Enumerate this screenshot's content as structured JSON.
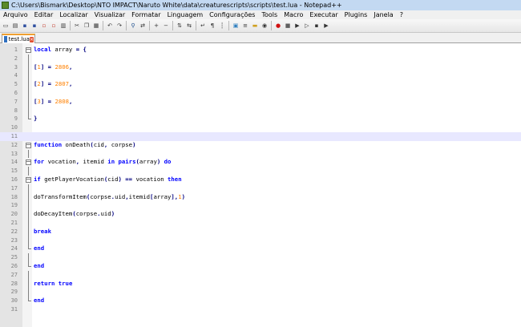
{
  "window": {
    "title": "C:\\Users\\Bismark\\Desktop\\NTO IMPACT\\Naruto White\\data\\creaturescripts\\scripts\\test.lua - Notepad++"
  },
  "menu": [
    "Arquivo",
    "Editar",
    "Localizar",
    "Visualizar",
    "Formatar",
    "Linguagem",
    "Configurações",
    "Tools",
    "Macro",
    "Executar",
    "Plugins",
    "Janela",
    "?"
  ],
  "toolbar_icons": [
    "new-icon",
    "open-icon",
    "save-icon",
    "save-all-icon",
    "close-icon",
    "close-all-icon",
    "print-icon",
    "sep",
    "cut-icon",
    "copy-icon",
    "paste-icon",
    "sep",
    "undo-icon",
    "redo-icon",
    "sep",
    "find-icon",
    "replace-icon",
    "sep",
    "zoom-in-icon",
    "zoom-out-icon",
    "sep",
    "sync-v-icon",
    "sync-h-icon",
    "sep",
    "word-wrap-icon",
    "show-all-chars-icon",
    "indent-guide-icon",
    "sep",
    "document-map-icon",
    "function-list-icon",
    "folder-icon",
    "monitor-icon",
    "sep",
    "record-icon",
    "stop-icon",
    "play-icon",
    "run-multiple-icon",
    "save-macro-icon",
    "run-icon"
  ],
  "tab": {
    "label": "test.lua"
  },
  "colors": {
    "keyword": "#0000ff",
    "number": "#ff8000",
    "operator": "#000080",
    "current_line": "#e8e8ff"
  },
  "current_line": 11,
  "lines": [
    {
      "n": "1",
      "fold": "box",
      "tokens": [
        [
          "kw",
          "local"
        ],
        [
          "txt",
          " array "
        ],
        [
          "punc",
          "="
        ],
        [
          "txt",
          " "
        ],
        [
          "punc",
          "{"
        ]
      ]
    },
    {
      "n": "2",
      "fold": "vline",
      "tokens": []
    },
    {
      "n": "3",
      "fold": "vline",
      "tokens": [
        [
          "punc",
          "["
        ],
        [
          "num",
          "1"
        ],
        [
          "punc",
          "]"
        ],
        [
          "txt",
          " "
        ],
        [
          "punc",
          "="
        ],
        [
          "txt",
          " "
        ],
        [
          "num",
          "2806"
        ],
        [
          "punc",
          ","
        ]
      ]
    },
    {
      "n": "4",
      "fold": "vline",
      "tokens": []
    },
    {
      "n": "5",
      "fold": "vline",
      "tokens": [
        [
          "punc",
          "["
        ],
        [
          "num",
          "2"
        ],
        [
          "punc",
          "]"
        ],
        [
          "txt",
          " "
        ],
        [
          "punc",
          "="
        ],
        [
          "txt",
          " "
        ],
        [
          "num",
          "2807"
        ],
        [
          "punc",
          ","
        ]
      ]
    },
    {
      "n": "6",
      "fold": "vline",
      "tokens": []
    },
    {
      "n": "7",
      "fold": "vline",
      "tokens": [
        [
          "punc",
          "["
        ],
        [
          "num",
          "3"
        ],
        [
          "punc",
          "]"
        ],
        [
          "txt",
          " "
        ],
        [
          "punc",
          "="
        ],
        [
          "txt",
          " "
        ],
        [
          "num",
          "2808"
        ],
        [
          "punc",
          ","
        ]
      ]
    },
    {
      "n": "8",
      "fold": "vline",
      "tokens": []
    },
    {
      "n": "9",
      "fold": "endmark",
      "tokens": [
        [
          "punc",
          "}"
        ]
      ]
    },
    {
      "n": "10",
      "fold": "",
      "tokens": []
    },
    {
      "n": "11",
      "fold": "",
      "tokens": []
    },
    {
      "n": "12",
      "fold": "box",
      "tokens": [
        [
          "kw",
          "function"
        ],
        [
          "txt",
          " onDeath"
        ],
        [
          "punc",
          "("
        ],
        [
          "txt",
          "cid"
        ],
        [
          "punc",
          ","
        ],
        [
          "txt",
          " corpse"
        ],
        [
          "punc",
          ")"
        ]
      ]
    },
    {
      "n": "13",
      "fold": "vline",
      "tokens": []
    },
    {
      "n": "14",
      "fold": "box",
      "tokens": [
        [
          "kw",
          "for"
        ],
        [
          "txt",
          " vocation"
        ],
        [
          "punc",
          ","
        ],
        [
          "txt",
          " itemid "
        ],
        [
          "kw",
          "in"
        ],
        [
          "txt",
          " "
        ],
        [
          "kw",
          "pairs"
        ],
        [
          "punc",
          "("
        ],
        [
          "txt",
          "array"
        ],
        [
          "punc",
          ")"
        ],
        [
          "txt",
          " "
        ],
        [
          "kw",
          "do"
        ]
      ]
    },
    {
      "n": "15",
      "fold": "vline",
      "tokens": []
    },
    {
      "n": "16",
      "fold": "box",
      "tokens": [
        [
          "kw",
          "if"
        ],
        [
          "txt",
          " getPlayerVocation"
        ],
        [
          "punc",
          "("
        ],
        [
          "txt",
          "cid"
        ],
        [
          "punc",
          ")"
        ],
        [
          "txt",
          " "
        ],
        [
          "punc",
          "=="
        ],
        [
          "txt",
          " vocation "
        ],
        [
          "kw",
          "then"
        ]
      ]
    },
    {
      "n": "17",
      "fold": "vline",
      "tokens": []
    },
    {
      "n": "18",
      "fold": "vline",
      "tokens": [
        [
          "txt",
          "doTransformItem"
        ],
        [
          "punc",
          "("
        ],
        [
          "txt",
          "corpse"
        ],
        [
          "punc",
          "."
        ],
        [
          "txt",
          "uid"
        ],
        [
          "punc",
          ","
        ],
        [
          "txt",
          "itemid"
        ],
        [
          "punc",
          "["
        ],
        [
          "txt",
          "array"
        ],
        [
          "punc",
          "],"
        ],
        [
          "num",
          "1"
        ],
        [
          "punc",
          ")"
        ]
      ]
    },
    {
      "n": "19",
      "fold": "vline",
      "tokens": []
    },
    {
      "n": "20",
      "fold": "vline",
      "tokens": [
        [
          "txt",
          "doDecayItem"
        ],
        [
          "punc",
          "("
        ],
        [
          "txt",
          "corpse"
        ],
        [
          "punc",
          "."
        ],
        [
          "txt",
          "uid"
        ],
        [
          "punc",
          ")"
        ]
      ]
    },
    {
      "n": "21",
      "fold": "vline",
      "tokens": []
    },
    {
      "n": "22",
      "fold": "vline",
      "tokens": [
        [
          "kw",
          "break"
        ]
      ]
    },
    {
      "n": "23",
      "fold": "vline",
      "tokens": []
    },
    {
      "n": "24",
      "fold": "endmark",
      "tokens": [
        [
          "kw",
          "end"
        ]
      ]
    },
    {
      "n": "25",
      "fold": "vline",
      "tokens": []
    },
    {
      "n": "26",
      "fold": "endmark",
      "tokens": [
        [
          "kw",
          "end"
        ]
      ]
    },
    {
      "n": "27",
      "fold": "vline",
      "tokens": []
    },
    {
      "n": "28",
      "fold": "vline",
      "tokens": [
        [
          "kw",
          "return"
        ],
        [
          "txt",
          " "
        ],
        [
          "kw",
          "true"
        ]
      ]
    },
    {
      "n": "29",
      "fold": "vline",
      "tokens": []
    },
    {
      "n": "30",
      "fold": "endmark",
      "tokens": [
        [
          "kw",
          "end"
        ]
      ]
    },
    {
      "n": "31",
      "fold": "",
      "tokens": []
    }
  ]
}
